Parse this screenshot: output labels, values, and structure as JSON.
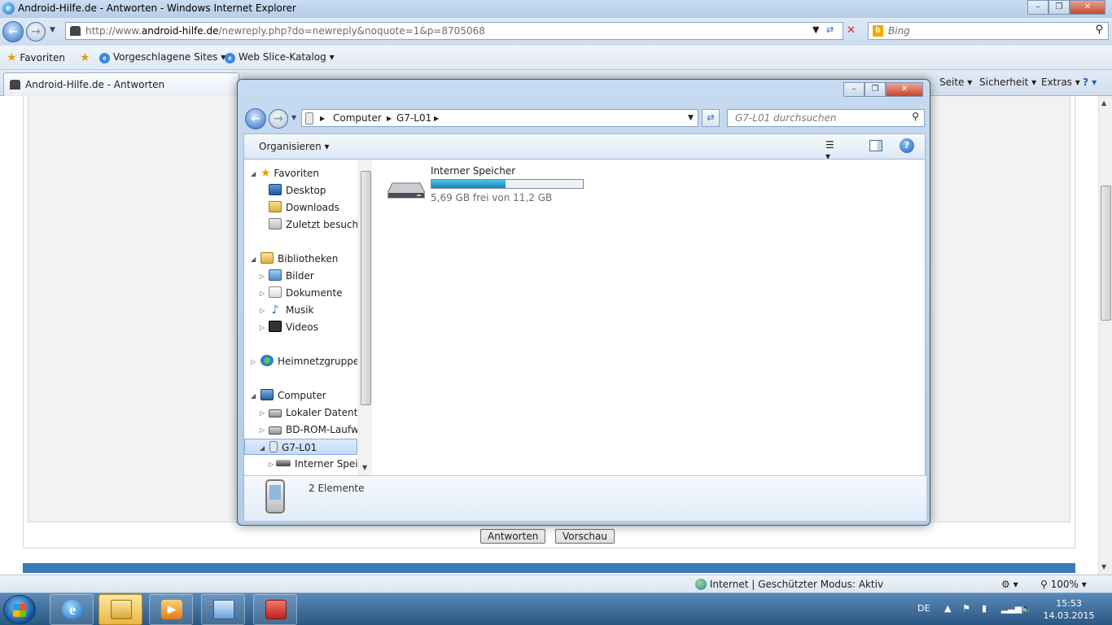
{
  "ie": {
    "title": "Android-Hilfe.de - Antworten - Windows Internet Explorer",
    "address_prefix": "http://www.",
    "address_domain": "android-hilfe.de",
    "address_rest": "/newreply.php?do=newreply&noquote=1&p=8705068",
    "search_placeholder": "Bing",
    "favbar": {
      "favorites": "Favoriten",
      "suggested": "Vorgeschlagene Sites",
      "webslice": "Web Slice-Katalog"
    },
    "tab_title": "Android-Hilfe.de - Antworten",
    "commands": {
      "page": "Seite",
      "safety": "Sicherheit",
      "extras": "Extras"
    },
    "page_buttons": {
      "reply": "Antworten",
      "preview": "Vorschau"
    },
    "status_zone": "Internet | Geschützter Modus: Aktiv",
    "zoom": "100%"
  },
  "explorer": {
    "breadcrumb": [
      "Computer",
      "G7-L01"
    ],
    "search_placeholder": "G7-L01 durchsuchen",
    "organize": "Organisieren",
    "nav": {
      "favorites": "Favoriten",
      "desktop": "Desktop",
      "downloads": "Downloads",
      "recent": "Zuletzt besucht",
      "libraries": "Bibliotheken",
      "pictures": "Bilder",
      "documents": "Dokumente",
      "music": "Musik",
      "videos": "Videos",
      "homegroup": "Heimnetzgruppe",
      "computer": "Computer",
      "local_disk": "Lokaler Datenträger (C:)",
      "bd_rom": "BD-ROM-Laufwerk",
      "device": "G7-L01",
      "internal_storage": "Interner Speicher"
    },
    "storage": {
      "name": "Interner Speicher",
      "info": "5,69 GB frei von 11,2 GB",
      "used_fraction": 0.49
    },
    "item_count": "2 Elemente"
  },
  "taskbar": {
    "language": "DE",
    "time": "15:53",
    "date": "14.03.2015"
  }
}
